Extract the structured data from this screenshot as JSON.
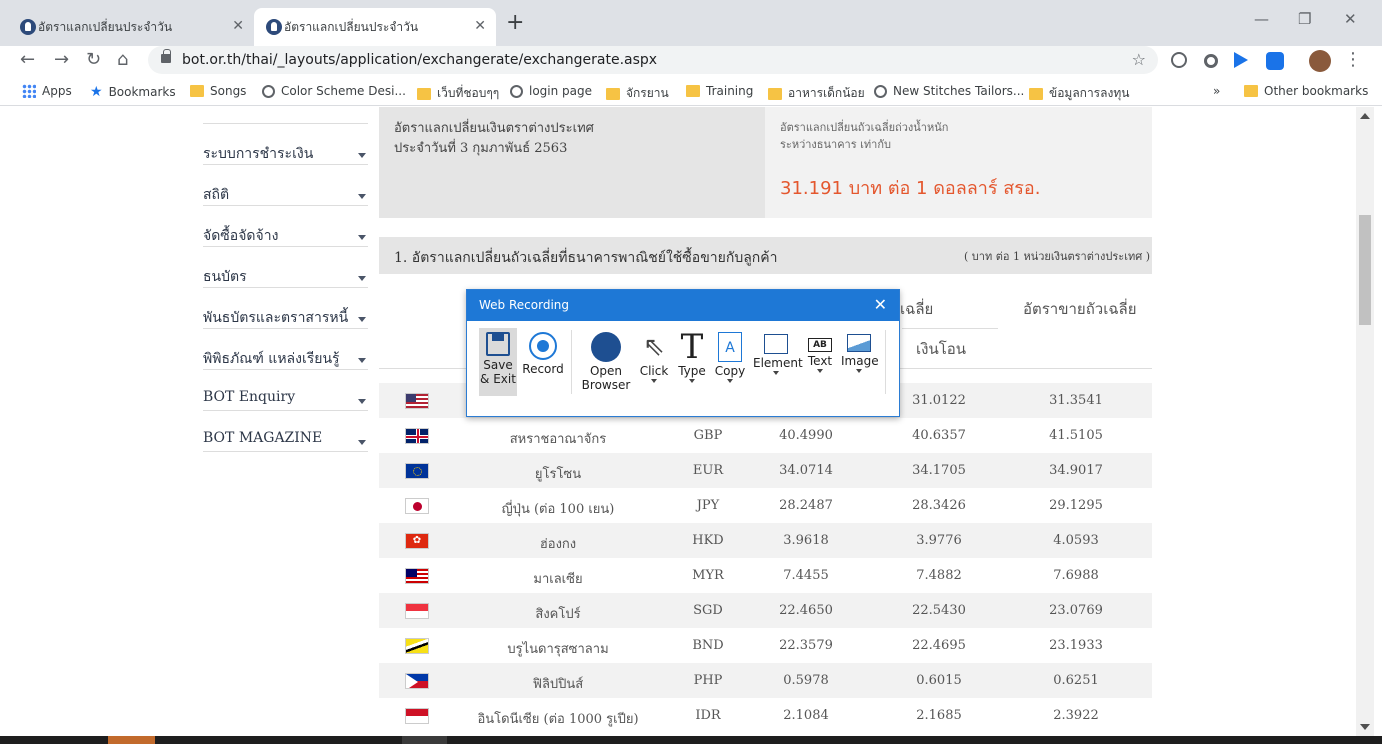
{
  "browser": {
    "tabs": [
      {
        "title": "อัตราแลกเปลี่ยนประจำวัน",
        "active": false
      },
      {
        "title": "อัตราแลกเปลี่ยนประจำวัน",
        "active": true
      }
    ],
    "url": "bot.or.th/thai/_layouts/application/exchangerate/exchangerate.aspx",
    "bookmarks": [
      {
        "label": "Apps",
        "icon": "apps-grid-icon"
      },
      {
        "label": "Bookmarks",
        "icon": "star-icon"
      },
      {
        "label": "Songs",
        "icon": "folder-icon"
      },
      {
        "label": "Color Scheme Desi...",
        "icon": "globe-icon"
      },
      {
        "label": "เว็บที่ชอบๆๆ",
        "icon": "folder-icon"
      },
      {
        "label": "login page",
        "icon": "globe-icon"
      },
      {
        "label": "จักรยาน",
        "icon": "folder-icon"
      },
      {
        "label": "Training",
        "icon": "folder-icon"
      },
      {
        "label": "อาหารเด็กน้อย",
        "icon": "folder-icon"
      },
      {
        "label": "New Stitches Tailors...",
        "icon": "globe-icon"
      },
      {
        "label": "ข้อมูลการลงทุน",
        "icon": "folder-icon"
      }
    ],
    "overflow": "»",
    "other_bookmarks": "Other bookmarks"
  },
  "sidebar": {
    "items": [
      {
        "label": "ระบบการชำระเงิน"
      },
      {
        "label": "สถิติ"
      },
      {
        "label": "จัดซื้อจัดจ้าง"
      },
      {
        "label": "ธนบัตร"
      },
      {
        "label": "พันธบัตรและตราสารหนี้"
      },
      {
        "label": "พิพิธภัณฑ์ แหล่งเรียนรู้"
      },
      {
        "label": "BOT Enquiry"
      },
      {
        "label": "BOT MAGAZINE"
      }
    ]
  },
  "info": {
    "left_line1": "อัตราแลกเปลี่ยนเงินตราต่างประเทศ",
    "left_line2": "ประจำวันที่ 3 กุมภาพันธ์ 2563",
    "right_line1": "อัตราแลกเปลี่ยนถัวเฉลี่ยถ่วงน้ำหนัก",
    "right_line2": "ระหว่างธนาคาร เท่ากับ",
    "highlight": "31.191 บาท ต่อ 1 ดอลลาร์ สรอ."
  },
  "section": {
    "title": "1. อัตราแลกเปลี่ยนถัวเฉลี่ยที่ธนาคารพาณิชย์ใช้ซื้อขายกับลูกค้า",
    "unit": "( บาท ต่อ 1 หน่วยเงินตราต่างประเทศ )"
  },
  "table": {
    "header_buy_partial": "เฉลี่ย",
    "header_buy_sub": "เงินโอน",
    "header_sell": "อัตราขายถัวเฉลี่ย",
    "rows": [
      {
        "name": "",
        "code": "",
        "buy1": "",
        "buy2": "31.0122",
        "sell": "31.3541",
        "flag": "us-flag-icon"
      },
      {
        "name": "สหราชอาณาจักร",
        "code": "GBP",
        "buy1": "40.4990",
        "buy2": "40.6357",
        "sell": "41.5105",
        "flag": "uk-flag-icon"
      },
      {
        "name": "ยูโรโซน",
        "code": "EUR",
        "buy1": "34.0714",
        "buy2": "34.1705",
        "sell": "34.9017",
        "flag": "eu-flag-icon"
      },
      {
        "name": "ญี่ปุ่น (ต่อ 100 เยน)",
        "code": "JPY",
        "buy1": "28.2487",
        "buy2": "28.3426",
        "sell": "29.1295",
        "flag": "japan-flag-icon"
      },
      {
        "name": "ฮ่องกง",
        "code": "HKD",
        "buy1": "3.9618",
        "buy2": "3.9776",
        "sell": "4.0593",
        "flag": "hongkong-flag-icon"
      },
      {
        "name": "มาเลเซีย",
        "code": "MYR",
        "buy1": "7.4455",
        "buy2": "7.4882",
        "sell": "7.6988",
        "flag": "malaysia-flag-icon"
      },
      {
        "name": "สิงคโปร์",
        "code": "SGD",
        "buy1": "22.4650",
        "buy2": "22.5430",
        "sell": "23.0769",
        "flag": "singapore-flag-icon"
      },
      {
        "name": "บรูไนดารุสซาลาม",
        "code": "BND",
        "buy1": "22.3579",
        "buy2": "22.4695",
        "sell": "23.1933",
        "flag": "brunei-flag-icon"
      },
      {
        "name": "ฟิลิปปินส์",
        "code": "PHP",
        "buy1": "0.5978",
        "buy2": "0.6015",
        "sell": "0.6251",
        "flag": "philippines-flag-icon"
      },
      {
        "name": "อินโดนีเซีย (ต่อ 1000 รูเปีย)",
        "code": "IDR",
        "buy1": "2.1084",
        "buy2": "2.1685",
        "sell": "2.3922",
        "flag": "indonesia-flag-icon"
      }
    ]
  },
  "recorder": {
    "title": "Web Recording",
    "buttons": [
      {
        "label1": "Save",
        "label2": "& Exit"
      },
      {
        "label1": "Record",
        "label2": ""
      },
      {
        "label1": "Open",
        "label2": "Browser"
      },
      {
        "label1": "Click",
        "label2": ""
      },
      {
        "label1": "Type",
        "label2": ""
      },
      {
        "label1": "Copy",
        "label2": ""
      },
      {
        "label1": "Element",
        "label2": ""
      },
      {
        "label1": "Text",
        "label2": ""
      },
      {
        "label1": "Image",
        "label2": ""
      }
    ]
  },
  "colors": {
    "accent_blue": "#1e78d6",
    "highlight_orange": "#e4572e"
  }
}
